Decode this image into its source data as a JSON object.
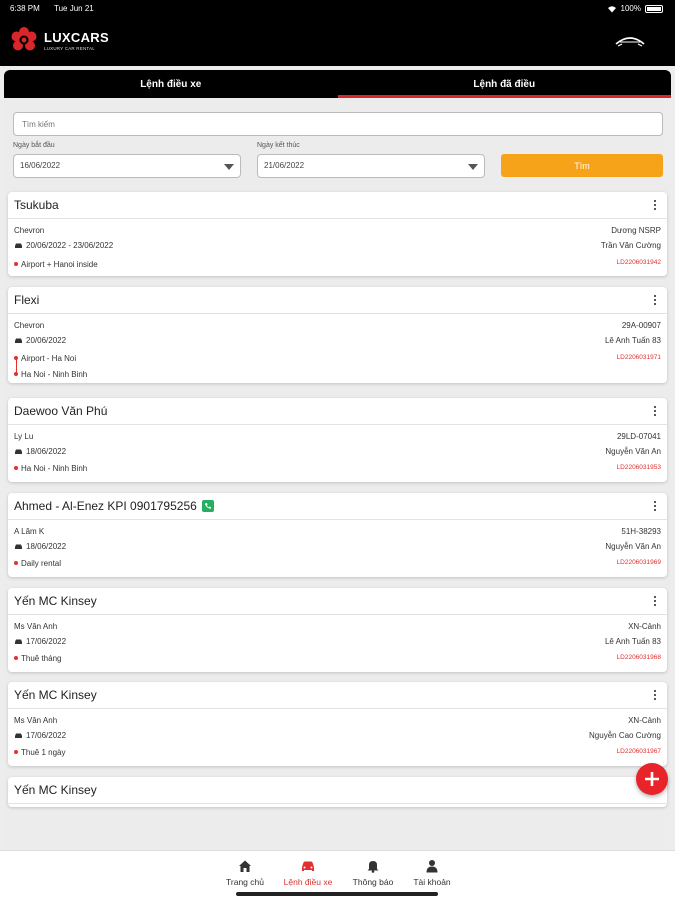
{
  "status": {
    "time": "6:38 PM",
    "date": "Tue Jun 21",
    "battery": "100%"
  },
  "brand": {
    "name": "LUXCARS",
    "tagline": "LUXURY CAR RENTAL"
  },
  "tabs": [
    {
      "label": "Lệnh điều xe"
    },
    {
      "label": "Lệnh đã điều"
    }
  ],
  "filters": {
    "search_placeholder": "Tìm kiếm",
    "start_label": "Ngày bắt đầu",
    "start_value": "16/06/2022",
    "end_label": "Ngày kết thúc",
    "end_value": "21/06/2022",
    "search_button": "Tìm"
  },
  "cards": [
    {
      "title": "Tsukuba",
      "customer": "Chevron",
      "date": "20/06/2022 - 23/06/2022",
      "routes": [
        "Airport + Hanoi inside"
      ],
      "plate": "Dương NSRP",
      "driver": "Trần Văn Cường",
      "code": "LD2206031942"
    },
    {
      "title": "Flexi",
      "customer": "Chevron",
      "date": "20/06/2022",
      "routes": [
        "Airport - Ha Noi",
        "Ha Noi - Ninh Binh"
      ],
      "plate": "29A-00907",
      "driver": "Lê Anh Tuấn 83",
      "code": "LD2206031971"
    },
    {
      "title": "Daewoo Văn Phú",
      "customer": "Ly Lu",
      "date": "18/06/2022",
      "routes": [
        "Ha Noi - Ninh Binh"
      ],
      "plate": "29LD-07041",
      "driver": "Nguyễn Văn An",
      "code": "LD2206031953"
    },
    {
      "title": "Ahmed - Al-Enez KPI 0901795256",
      "customer": "A Lâm K",
      "date": "18/06/2022",
      "routes": [
        "Daily rental"
      ],
      "plate": "51H-38293",
      "driver": "Nguyễn Văn An",
      "code": "LD2206031969"
    },
    {
      "title": "Yến MC Kinsey",
      "customer": "Ms Vân Anh",
      "date": "17/06/2022",
      "routes": [
        "Thuê tháng"
      ],
      "plate": "XN-Cảnh",
      "driver": "Lê Anh Tuấn 83",
      "code": "LD2206031968"
    },
    {
      "title": "Yến MC Kinsey",
      "customer": "Ms Vân Anh",
      "date": "17/06/2022",
      "routes": [
        "Thuê 1 ngày"
      ],
      "plate": "XN-Cảnh",
      "driver": "Nguyễn Cao Cường",
      "code": "LD2206031967"
    },
    {
      "title": "Yến MC Kinsey"
    }
  ],
  "nav": [
    {
      "label": "Trang chủ",
      "icon": "home-icon"
    },
    {
      "label": "Lệnh điều xe",
      "icon": "car-icon"
    },
    {
      "label": "Thông báo",
      "icon": "bell-icon"
    },
    {
      "label": "Tài khoản",
      "icon": "user-icon"
    }
  ],
  "colors": {
    "accent": "#d9262a",
    "button": "#f7a31a",
    "code": "#e03030"
  }
}
